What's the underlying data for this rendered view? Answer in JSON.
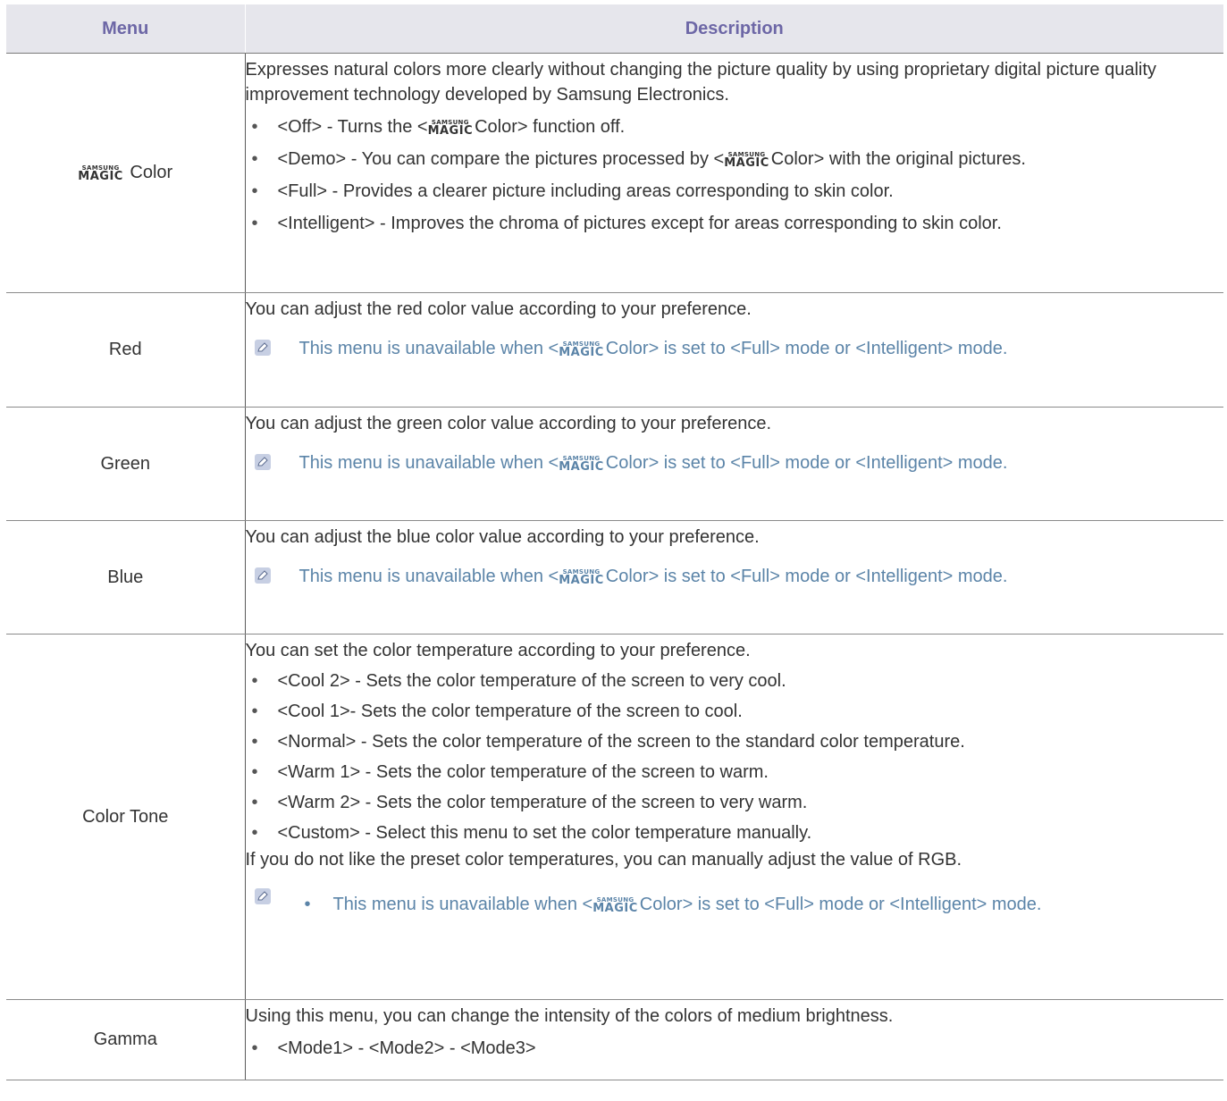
{
  "header": {
    "menu": "Menu",
    "description": "Description"
  },
  "logo": {
    "top": "SAMSUNG",
    "bottom": "MAGIC"
  },
  "rows": {
    "magic_color": {
      "menu_suffix": "Color",
      "intro": "Expresses natural colors more clearly without changing the picture quality by using proprietary digital picture quality improvement technology developed by Samsung Electronics.",
      "items": [
        {
          "pre": "<Off> - Turns the <",
          "post": "Color> function off."
        },
        {
          "pre": "<Demo> - You can compare the pictures processed by <",
          "post": "Color> with the original pictures."
        },
        {
          "text": "<Full> - Provides a clearer picture including areas corresponding to skin color."
        },
        {
          "text": "<Intelligent> - Improves the chroma of pictures except for areas corresponding to skin color."
        }
      ]
    },
    "red": {
      "menu": "Red",
      "intro": "You can adjust the red color value according to your preference.",
      "note_pre": "This menu is unavailable when <",
      "note_post": "Color> is set to <Full> mode or <Intelligent> mode."
    },
    "green": {
      "menu": "Green",
      "intro": "You can adjust the green color value according to your preference.",
      "note_pre": "This menu is unavailable when <",
      "note_post": "Color> is set to <Full> mode or <Intelligent> mode."
    },
    "blue": {
      "menu": "Blue",
      "intro": "You can adjust the blue color value according to your preference.",
      "note_pre": "This menu is unavailable when <",
      "note_post": "Color> is set to <Full> mode or <Intelligent> mode."
    },
    "color_tone": {
      "menu": "Color Tone",
      "intro": "You can set the color temperature according to your preference.",
      "items": [
        "<Cool 2> - Sets the color temperature of the screen to very cool.",
        "<Cool 1>- Sets the color temperature of the screen to cool.",
        "<Normal> - Sets the color temperature of the screen to the standard color temperature.",
        "<Warm 1> - Sets the color temperature of the screen to warm.",
        "<Warm 2> - Sets the color temperature of the screen to very warm.",
        "<Custom> - Select this menu to set the color temperature manually."
      ],
      "extra": "If you do not like the preset color temperatures, you can manually adjust the value of RGB.",
      "note_pre": "This menu is unavailable when <",
      "note_post": "Color> is set to <Full> mode or <Intelligent> mode."
    },
    "gamma": {
      "menu": "Gamma",
      "intro": "Using this menu, you can change the intensity of the colors of medium brightness.",
      "items": [
        "<Mode1> - <Mode2> - <Mode3>"
      ]
    }
  },
  "bullet": "•",
  "colors": {
    "header_bg": "#e6e6ec",
    "header_text": "#6d67a6",
    "note_text": "#5b84a8"
  }
}
